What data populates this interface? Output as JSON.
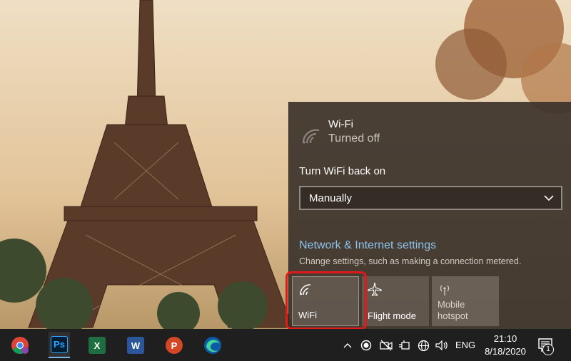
{
  "flyout": {
    "network_name": "Wi-Fi",
    "network_status": "Turned off",
    "turn_on_label": "Turn WiFi back on",
    "turn_on_value": "Manually",
    "settings_link": "Network & Internet settings",
    "settings_desc": "Change settings, such as making a connection metered."
  },
  "quick_actions": [
    {
      "label": "WiFi",
      "icon": "wifi-icon",
      "state": "off"
    },
    {
      "label": "Flight mode",
      "icon": "airplane-icon",
      "state": "off"
    },
    {
      "label": "Mobile\nhotspot",
      "icon": "hotspot-icon",
      "state": "disabled"
    }
  ],
  "taskbar": {
    "apps": [
      {
        "name": "chrome-icon"
      },
      {
        "name": "photoshop-icon",
        "label": "Ps"
      },
      {
        "name": "excel-icon",
        "label": "X"
      },
      {
        "name": "word-icon",
        "label": "W"
      },
      {
        "name": "powerpoint-icon",
        "label": "P"
      },
      {
        "name": "edge-icon"
      }
    ],
    "tray": {
      "language": "ENG",
      "time": "21:10",
      "date": "8/18/2020",
      "notification_count": "1"
    }
  },
  "colors": {
    "flyout_bg": "#3c342c",
    "link": "#8cc2ec",
    "highlight": "#e0191b",
    "taskbar": "#1f1f1f"
  }
}
